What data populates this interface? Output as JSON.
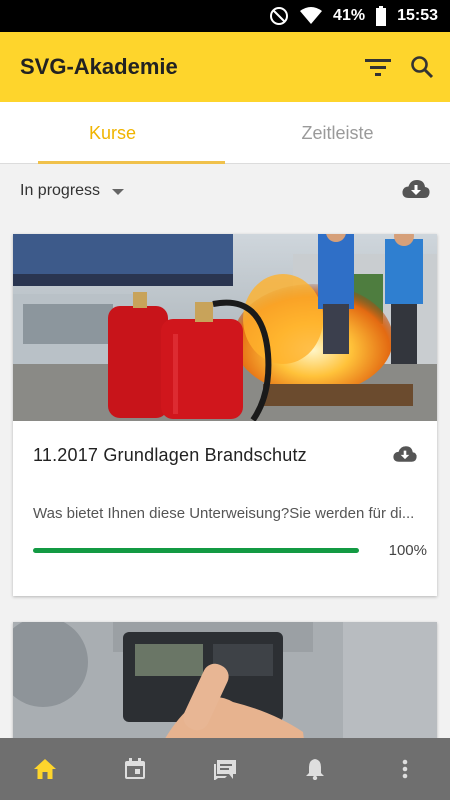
{
  "status": {
    "battery": "41%",
    "time": "15:53"
  },
  "appbar": {
    "title": "SVG-Akademie",
    "icons": [
      "filter-icon",
      "search-icon"
    ]
  },
  "tabs": [
    {
      "label": "Kurse",
      "active": true
    },
    {
      "label": "Zeitleiste",
      "active": false
    }
  ],
  "filter": {
    "selected": "In progress"
  },
  "courses": [
    {
      "title": "11.2017 Grundlagen Brandschutz",
      "description": "Was bietet Ihnen diese Unterweisung?Sie werden für di...",
      "progress": 100,
      "progress_label": "100%"
    }
  ],
  "bottom_nav": [
    "home-icon",
    "calendar-icon",
    "forum-icon",
    "notifications-icon",
    "more-icon"
  ],
  "colors": {
    "accent": "#fed52c",
    "tab_active": "#f0b400",
    "progress": "#139a43",
    "nav_bg": "#6f6f6f"
  }
}
